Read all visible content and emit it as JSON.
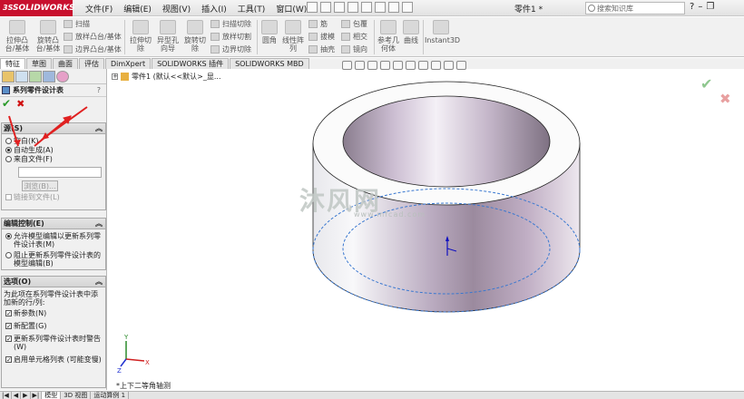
{
  "app": {
    "brand": "SOLIDWORKS",
    "brand_prefix": "3S",
    "document_title": "零件1 *"
  },
  "menu": [
    "文件(F)",
    "编辑(E)",
    "视图(V)",
    "插入(I)",
    "工具(T)",
    "窗口(W)"
  ],
  "search": {
    "placeholder": "搜索知识库"
  },
  "toolbar": {
    "big": [
      {
        "label": "拉伸凸\n台/基体"
      },
      {
        "label": "旋转凸\n台/基体"
      },
      {
        "label": "拉伸切\n除"
      },
      {
        "label": "异型孔\n向导"
      },
      {
        "label": "旋转切\n除"
      },
      {
        "label": "圆角"
      },
      {
        "label": "线性阵\n列"
      },
      {
        "label": "参考几\n何体"
      },
      {
        "label": "曲线"
      },
      {
        "label": "Instant3D"
      }
    ],
    "small_1": [
      "扫描",
      "放样凸台/基体",
      "边界凸台/基体"
    ],
    "small_2": [
      "扫描切除",
      "放样切割",
      "边界切除"
    ],
    "small_3": [
      "筋",
      "拔模",
      "抽壳"
    ],
    "small_4": [
      "包覆",
      "相交",
      "镜向"
    ]
  },
  "tabs": [
    "特征",
    "草图",
    "曲面",
    "评估",
    "DimXpert",
    "SOLIDWORKS 插件",
    "SOLIDWORKS MBD"
  ],
  "panel": {
    "title": "系列零件设计表",
    "help": "?",
    "source": {
      "header": "源(S)",
      "options": [
        "空白(K)",
        "自动生成(A)",
        "来自文件(F)"
      ],
      "browse": "浏览(B)...",
      "link": "链接到文件(L)"
    },
    "edit_control": {
      "header": "编辑控制(E)",
      "options": [
        "允许模型编辑以更新系列零件设计表(M)",
        "阻止更新系列零件设计表的模型编辑(B)"
      ]
    },
    "options": {
      "header": "选项(O)",
      "desc": "为此项在系列零件设计表中添加新的行/列:",
      "checks": [
        "新参数(N)",
        "新配置(G)",
        "更新系列零件设计表时警告(W)",
        "启用单元格列表 (可能变慢)"
      ]
    }
  },
  "tree": {
    "label": "零件1 (默认<<默认>_显..."
  },
  "viewport": {
    "view_name": "*上下二等角轴测"
  },
  "watermark": {
    "text": "沐风网",
    "url": "www.mfcad.com"
  },
  "bottom_tabs": [
    "模型",
    "3D 视图",
    "运动算例 1"
  ],
  "colors": {
    "brand_red": "#c8102e",
    "ok_green": "#2a9a2a",
    "cancel_red": "#d01010",
    "arrow_red": "#e02020"
  }
}
